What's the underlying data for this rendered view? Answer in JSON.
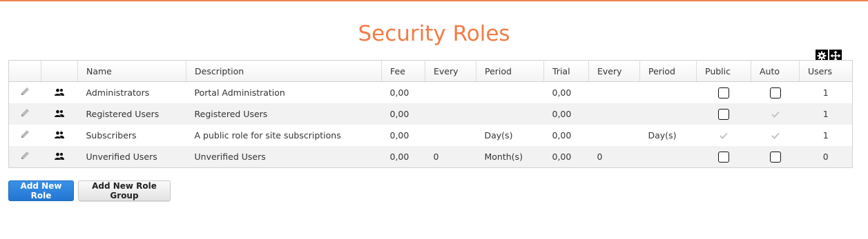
{
  "page": {
    "title": "Security Roles"
  },
  "table": {
    "headers": [
      "",
      "",
      "Name",
      "Description",
      "Fee",
      "Every",
      "Period",
      "Trial",
      "Every",
      "Period",
      "Public",
      "Auto",
      "Users"
    ],
    "rows": [
      {
        "name": "Administrators",
        "description": "Portal Administration",
        "fee": "0,00",
        "every": "",
        "period": "",
        "trial": "0,00",
        "trial_every": "",
        "trial_period": "",
        "public": "checkbox",
        "auto": "checkbox",
        "users": "1"
      },
      {
        "name": "Registered Users",
        "description": "Registered Users",
        "fee": "0,00",
        "every": "",
        "period": "",
        "trial": "0,00",
        "trial_every": "",
        "trial_period": "",
        "public": "checkbox",
        "auto": "check",
        "users": "1"
      },
      {
        "name": "Subscribers",
        "description": "A public role for site subscriptions",
        "fee": "0,00",
        "every": "",
        "period": "Day(s)",
        "trial": "0,00",
        "trial_every": "",
        "trial_period": "Day(s)",
        "public": "check",
        "auto": "check",
        "users": "1"
      },
      {
        "name": "Unverified Users",
        "description": "Unverified Users",
        "fee": "0,00",
        "every": "0",
        "period": "Month(s)",
        "trial": "0,00",
        "trial_every": "0",
        "trial_period": "",
        "public": "checkbox",
        "auto": "checkbox",
        "users": "0"
      }
    ]
  },
  "buttons": {
    "add_role": "Add New Role",
    "add_role_group": "Add New Role Group"
  },
  "icons": {
    "edit": "pencil-icon",
    "roles": "users-icon",
    "settings": "gear-icon",
    "move": "move-icon"
  },
  "colors": {
    "accent": "#f27c45",
    "primary": "#2a7fd8"
  }
}
